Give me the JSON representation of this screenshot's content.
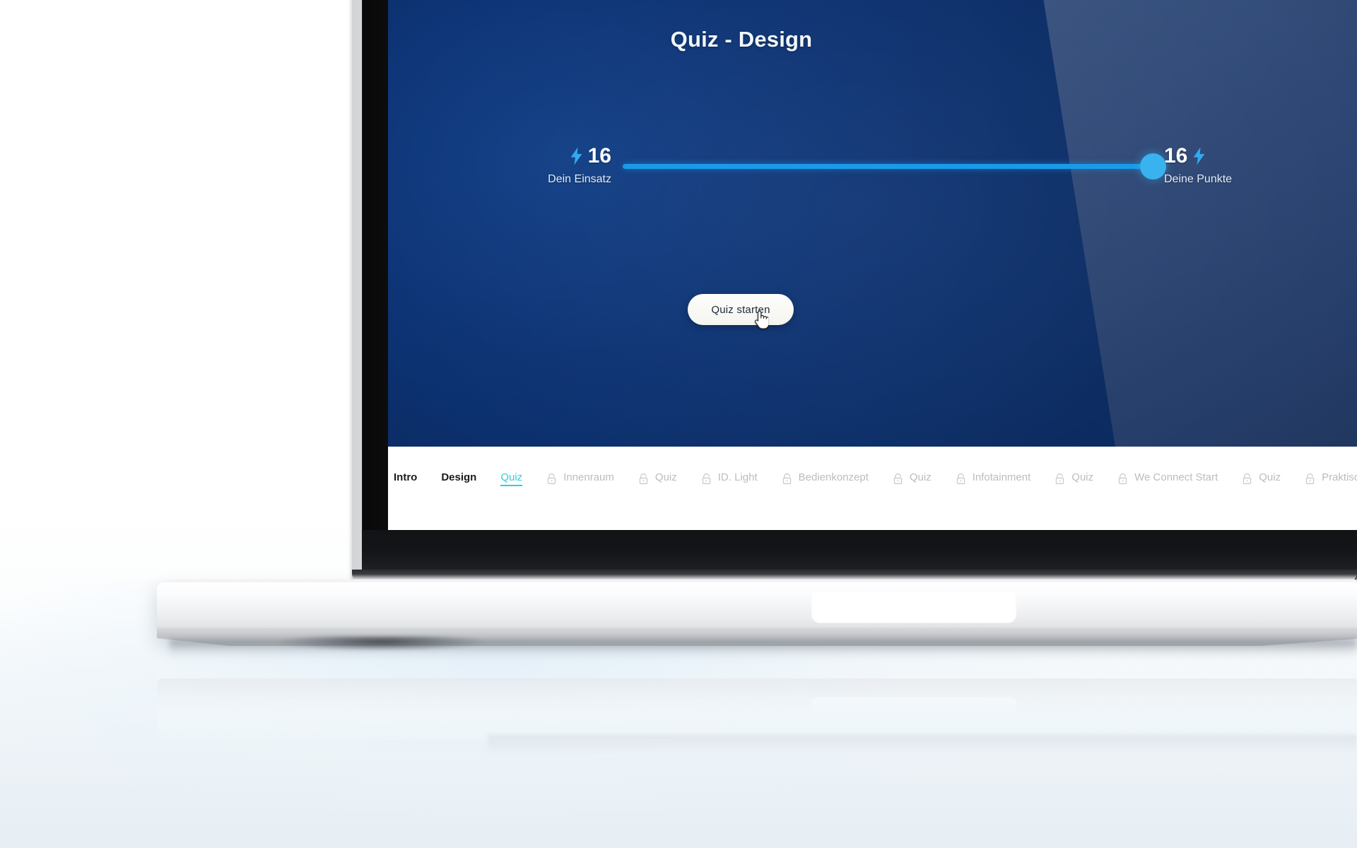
{
  "screen": {
    "title": "Quiz - Design",
    "score": {
      "stake": {
        "value": "16",
        "label": "Dein Einsatz",
        "icon": "lightning-bolt-icon"
      },
      "points": {
        "value": "16",
        "label": "Deine Punkte",
        "icon": "lightning-bolt-icon"
      },
      "slider_fill_percent": 100
    },
    "start_button": {
      "label": "Quiz starten"
    },
    "nav": {
      "items": [
        {
          "label": "Intro",
          "state": "plain",
          "locked": false
        },
        {
          "label": "Design",
          "state": "plain",
          "locked": false
        },
        {
          "label": "Quiz",
          "state": "active",
          "locked": false
        },
        {
          "label": "Innenraum",
          "state": "locked",
          "locked": true
        },
        {
          "label": "Quiz",
          "state": "locked",
          "locked": true
        },
        {
          "label": "ID. Light",
          "state": "locked",
          "locked": true
        },
        {
          "label": "Bedienkonzept",
          "state": "locked",
          "locked": true
        },
        {
          "label": "Quiz",
          "state": "locked",
          "locked": true
        },
        {
          "label": "Infotainment",
          "state": "locked",
          "locked": true
        },
        {
          "label": "Quiz",
          "state": "locked",
          "locked": true
        },
        {
          "label": "We Connect Start",
          "state": "locked",
          "locked": true
        },
        {
          "label": "Quiz",
          "state": "locked",
          "locked": true
        },
        {
          "label": "Praktisc",
          "state": "locked",
          "locked": true
        }
      ]
    }
  },
  "colors": {
    "screen_dark_blue": "#0a2c66",
    "screen_wedge_blue": "#2f4876",
    "slider_blue": "#1a9bea",
    "knob_blue": "#39b3f0",
    "active_tab_cyan": "#2bd0d8",
    "locked_text_gray": "#b9bdc0",
    "button_face": "#f9f9f6"
  }
}
